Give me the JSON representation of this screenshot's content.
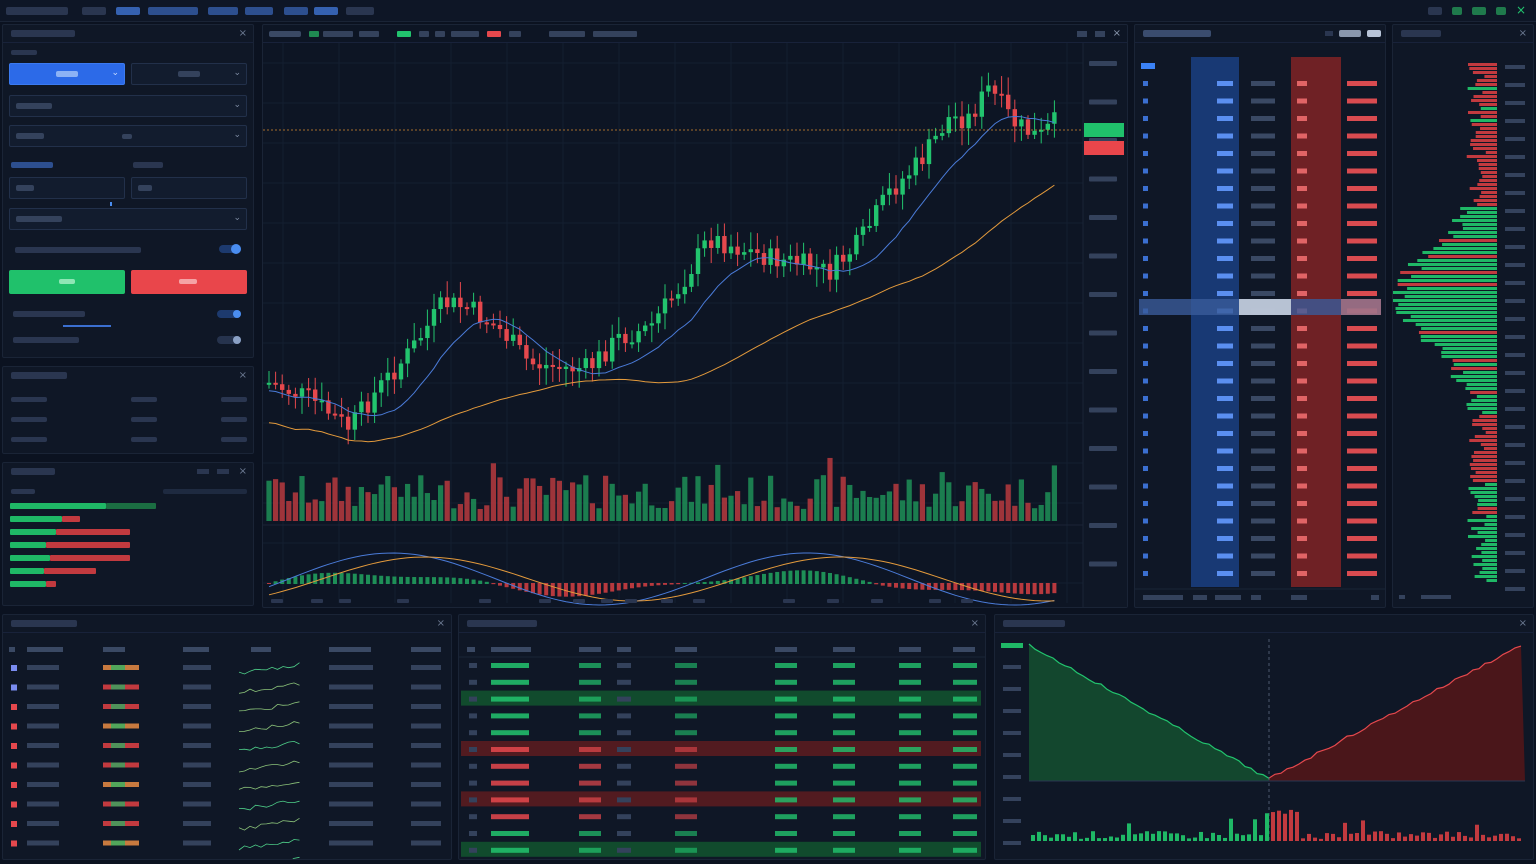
{
  "colors": {
    "bg": "#0b1220",
    "panel": "#0f1726",
    "up": "#22c46e",
    "down": "#e5484d",
    "accent": "#3b82f6",
    "ema_fast": "#4a7bd8",
    "ema_slow": "#e39a3c"
  },
  "icons": {
    "close": "×",
    "chevron": "⌄",
    "minimize": "–",
    "maximize": "□"
  }
}
